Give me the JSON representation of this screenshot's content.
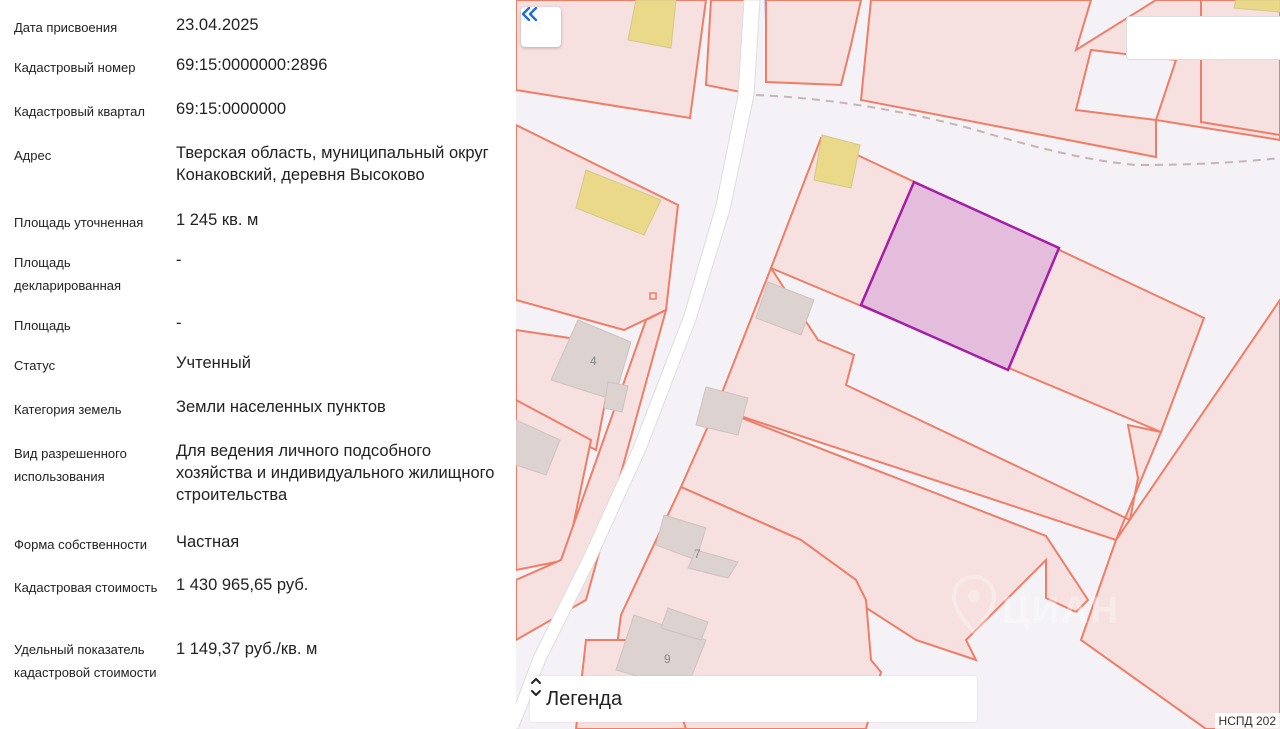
{
  "info": {
    "rows": [
      {
        "label": "Дата присвоения",
        "value": "23.04.2025"
      },
      {
        "label": "Кадастровый номер",
        "value": "69:15:0000000:2896"
      },
      {
        "label": "Кадастровый квартал",
        "value": "69:15:0000000"
      },
      {
        "label": "Адрес",
        "value": "Тверская область, муниципальный округ Конаковский, деревня Высоково"
      },
      {
        "label": "Площадь уточненная",
        "value": "1 245 кв. м"
      },
      {
        "label": "Площадь декларированная",
        "value": "-"
      },
      {
        "label": "Площадь",
        "value": "-"
      },
      {
        "label": "Статус",
        "value": "Учтенный"
      },
      {
        "label": "Категория земель",
        "value": "Земли населенных пунктов"
      },
      {
        "label": "Вид разрешенного использования",
        "value": "Для ведения личного подсобного хозяйства и индивидуального жилищного строительства"
      },
      {
        "label": "Форма собственности",
        "value": "Частная"
      },
      {
        "label": "Кадастровая стоимость",
        "value": "1 430 965,65 руб."
      },
      {
        "label": "Удельный показатель кадастровой стоимости",
        "value": "1 149,37 руб./кв. м"
      }
    ]
  },
  "map": {
    "collapse_icon": "double-chevron-left-icon",
    "house_numbers": [
      "4",
      "7",
      "9"
    ],
    "legend_label": "Легенда",
    "legend_toggle_icon": "chevron-up-down-icon",
    "attribution": "НСПД 202",
    "watermark_icon": "cian-location-pin-icon",
    "watermark_text": "ЦИАН",
    "colors": {
      "parcel_fill": "#f6e0e0",
      "parcel_stroke": "#ee7e66",
      "selected_fill": "#e4bcdc",
      "selected_stroke": "#a41fa8",
      "building_fill": "#dcd2d0",
      "yellow_building": "#ebd98a",
      "road": "#ffffff",
      "water": "#b8c6ef"
    }
  }
}
